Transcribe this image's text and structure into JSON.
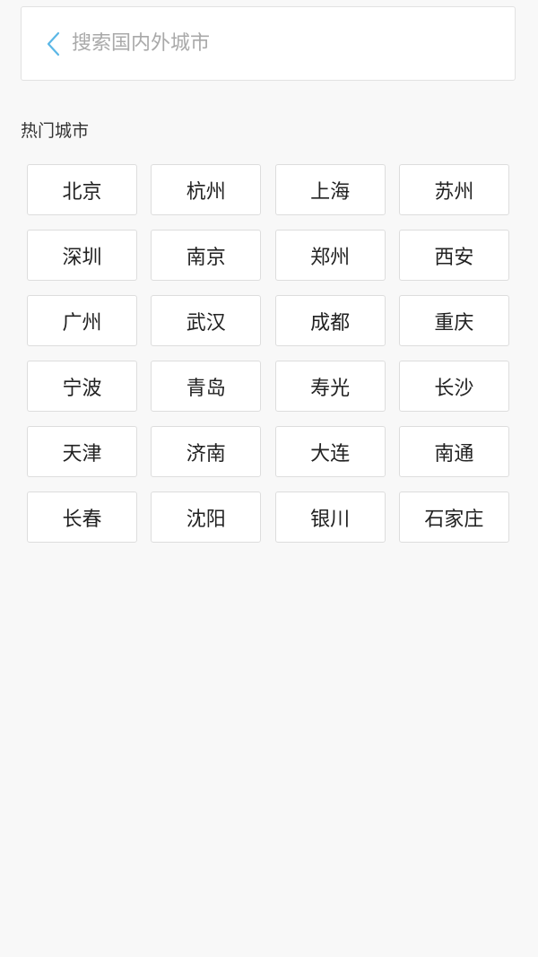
{
  "search": {
    "placeholder": "搜索国内外城市",
    "value": "",
    "back_icon": "chevron-left-icon",
    "back_icon_color": "#5bb7e6"
  },
  "hot_cities": {
    "title": "热门城市",
    "cities": [
      "北京",
      "杭州",
      "上海",
      "苏州",
      "深圳",
      "南京",
      "郑州",
      "西安",
      "广州",
      "武汉",
      "成都",
      "重庆",
      "宁波",
      "青岛",
      "寿光",
      "长沙",
      "天津",
      "济南",
      "大连",
      "南通",
      "长春",
      "沈阳",
      "银川",
      "石家庄"
    ]
  }
}
